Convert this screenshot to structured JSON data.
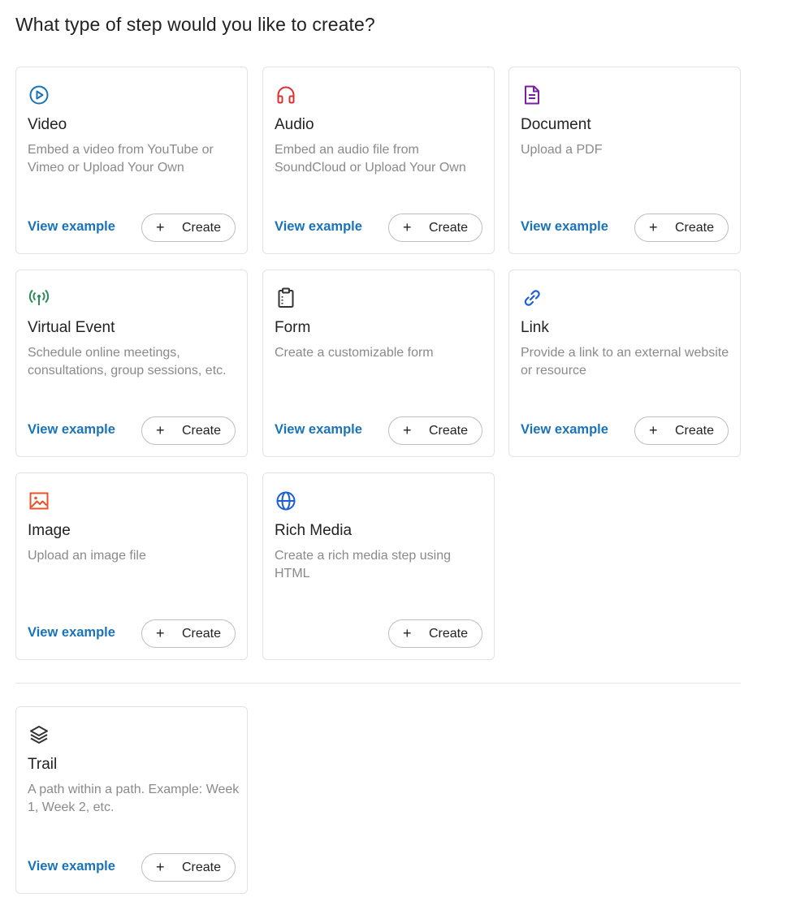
{
  "heading": "What type of step would you like to create?",
  "create_label": "Create",
  "create_plus": "+",
  "view_example_label": "View example",
  "cards": [
    {
      "title": "Video",
      "description": "Embed a video from YouTube or Vimeo or Upload Your Own",
      "icon": "play-circle-icon",
      "color": "#1a73b8",
      "has_example": true
    },
    {
      "title": "Audio",
      "description": "Embed an audio file from SoundCloud or Upload Your Own",
      "icon": "headphones-icon",
      "color": "#d9302c",
      "has_example": true
    },
    {
      "title": "Document",
      "description": "Upload a PDF",
      "icon": "document-icon",
      "color": "#7b1fa2",
      "has_example": true
    },
    {
      "title": "Virtual Event",
      "description": "Schedule online meetings, consultations, group sessions, etc.",
      "icon": "broadcast-icon",
      "color": "#2e8b57",
      "has_example": true
    },
    {
      "title": "Form",
      "description": "Create a customizable form",
      "icon": "clipboard-icon",
      "color": "#333333",
      "has_example": true
    },
    {
      "title": "Link",
      "description": "Provide a link to an external website or resource",
      "icon": "link-icon",
      "color": "#1a5fd8",
      "has_example": true
    },
    {
      "title": "Image",
      "description": "Upload an image file",
      "icon": "image-icon",
      "color": "#e8542a",
      "has_example": true
    },
    {
      "title": "Rich Media",
      "description": "Create a rich media step using HTML",
      "icon": "globe-icon",
      "color": "#1a5fd8",
      "has_example": false
    },
    {
      "title": "Trail",
      "description": "A path within a path. Example: Week 1, Week 2, etc.",
      "icon": "layers-icon",
      "color": "#333333",
      "has_example": true
    }
  ]
}
